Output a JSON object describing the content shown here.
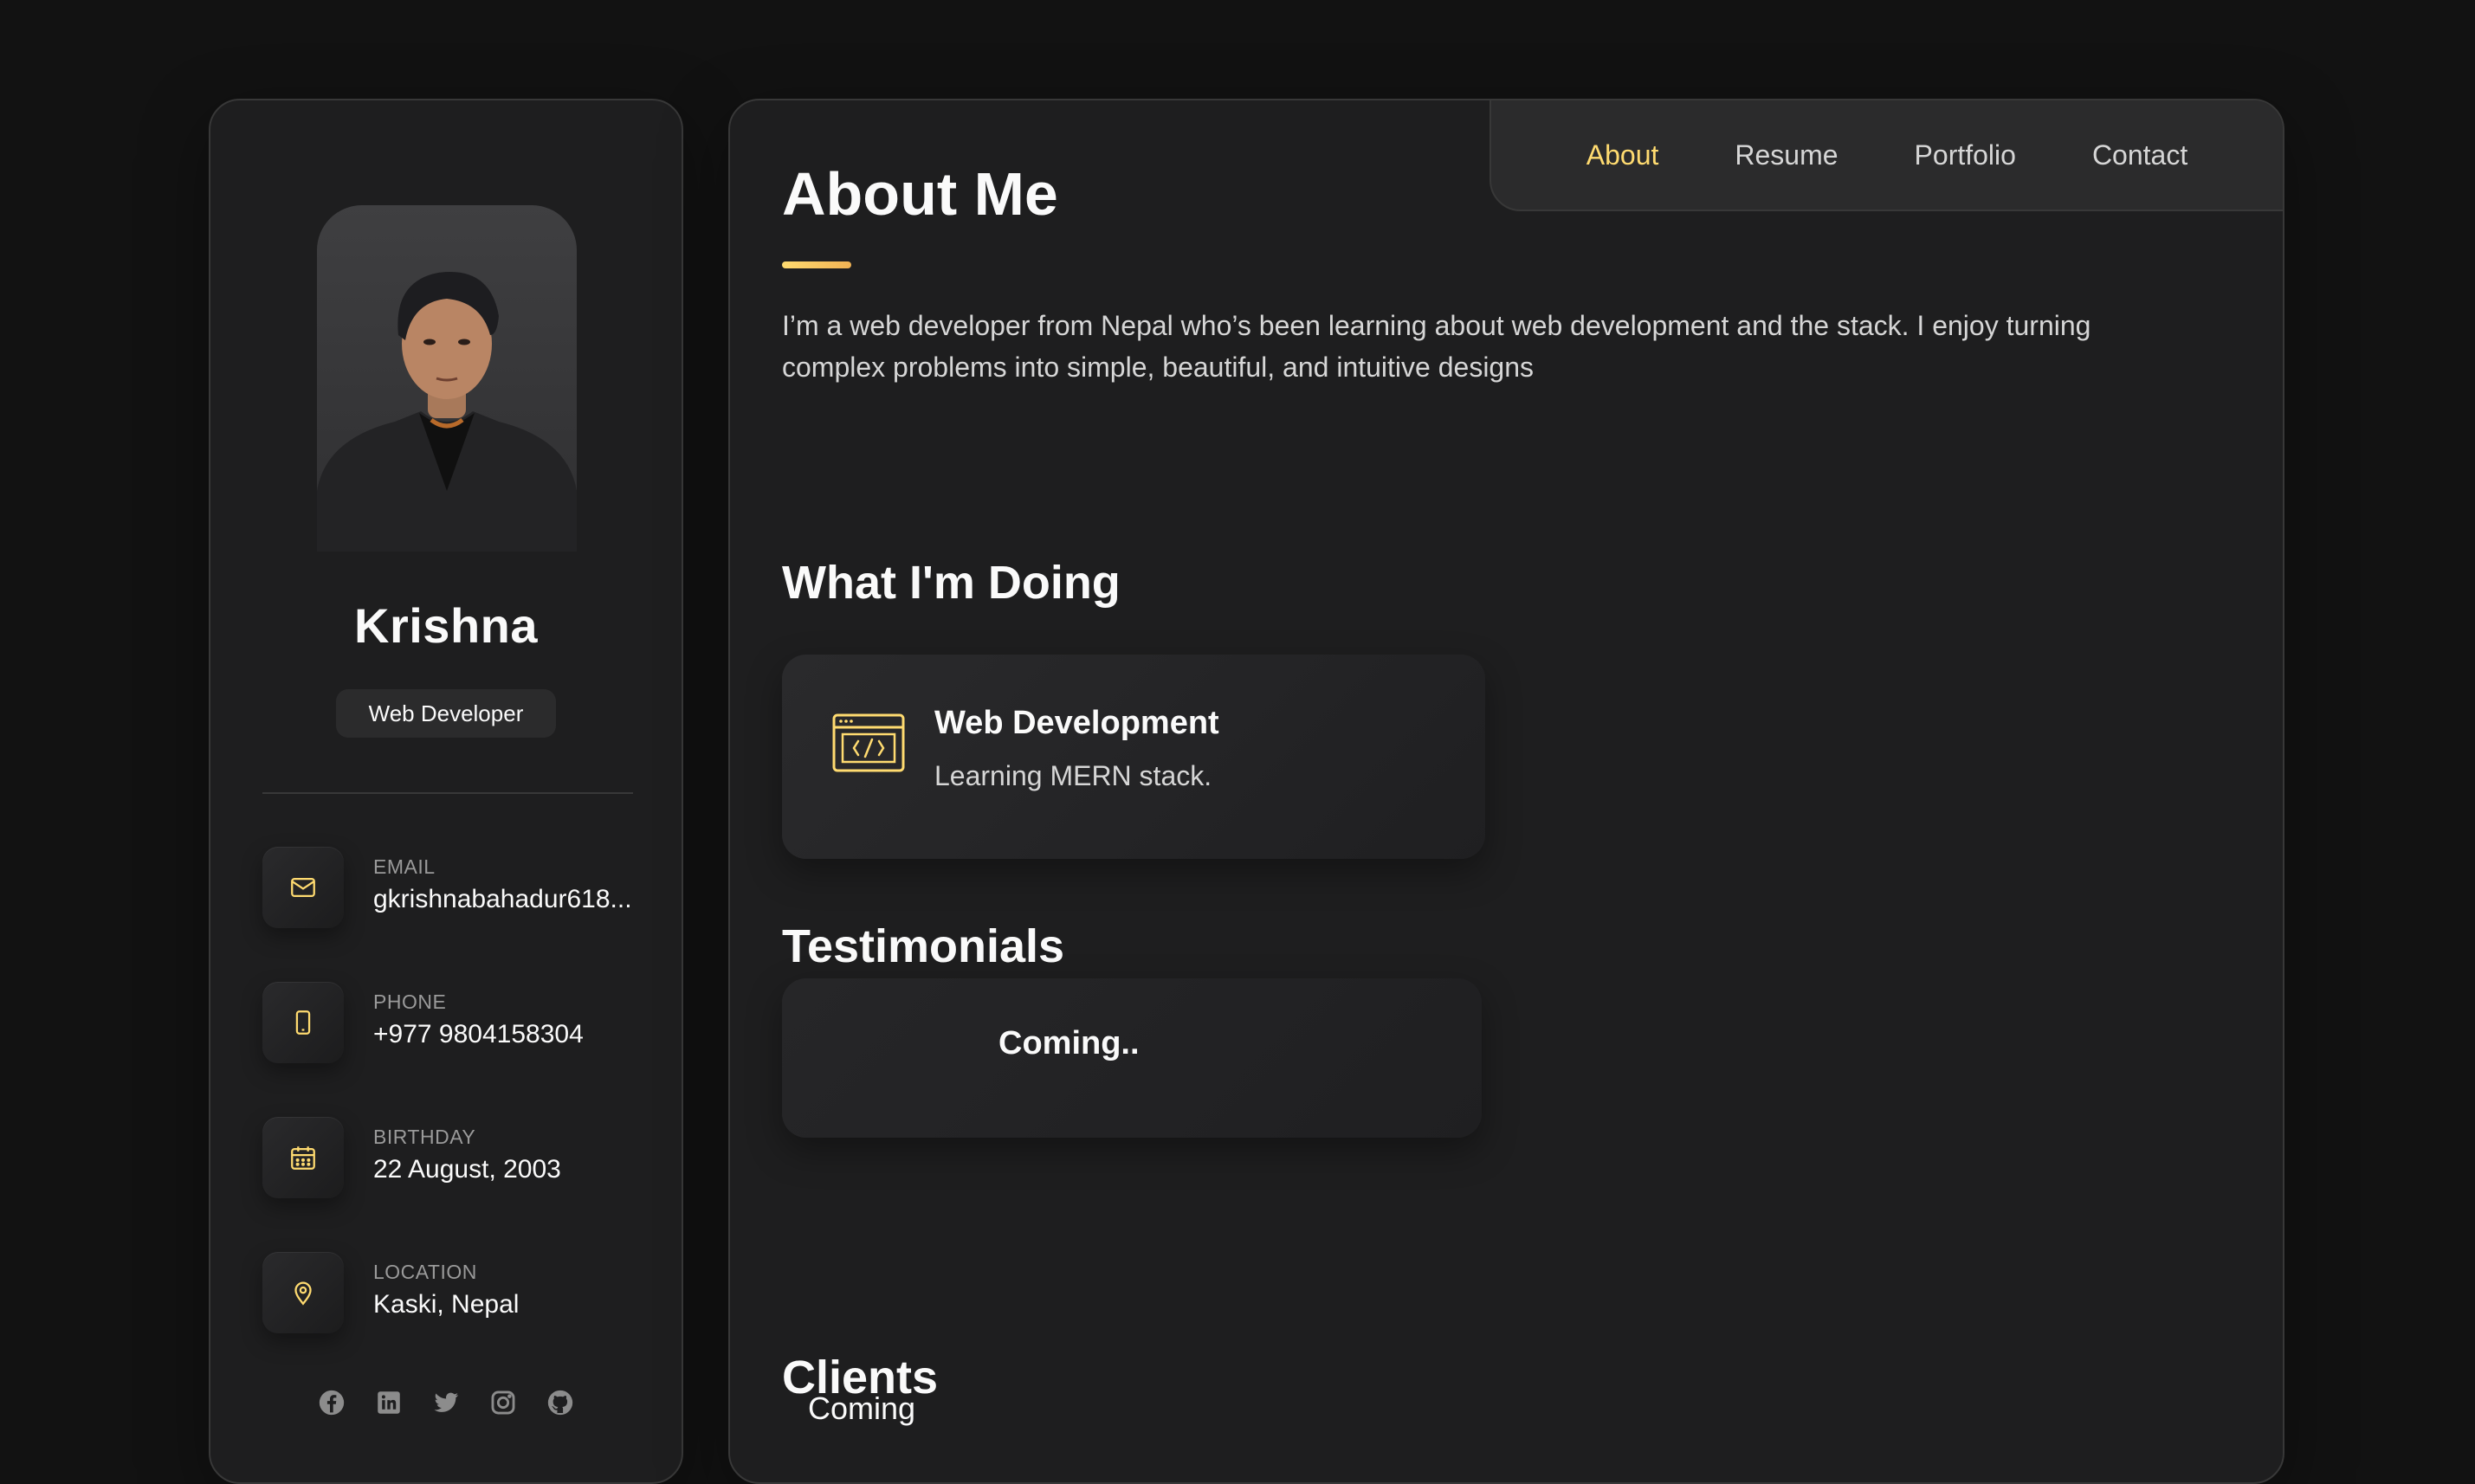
{
  "profile": {
    "name": "Krishna",
    "title": "Web Developer"
  },
  "contacts": [
    {
      "icon": "mail-icon",
      "label": "Email",
      "value": "gkrishnabahadur618..."
    },
    {
      "icon": "phone-icon",
      "label": "Phone",
      "value": "+977 9804158304"
    },
    {
      "icon": "calendar-icon",
      "label": "Birthday",
      "value": "22 August, 2003"
    },
    {
      "icon": "location-pin-icon",
      "label": "Location",
      "value": "Kaski, Nepal"
    }
  ],
  "socials": [
    "facebook-icon",
    "linkedin-icon",
    "twitter-icon",
    "instagram-icon",
    "github-icon"
  ],
  "nav": {
    "items": [
      {
        "label": "About",
        "active": true
      },
      {
        "label": "Resume",
        "active": false
      },
      {
        "label": "Portfolio",
        "active": false
      },
      {
        "label": "Contact",
        "active": false
      }
    ]
  },
  "about": {
    "heading": "About Me",
    "text": "I’m a web developer from Nepal who’s been learning about web development and the stack. I enjoy turning complex problems into simple, beautiful, and intuitive designs"
  },
  "doing": {
    "heading": "What I'm Doing",
    "service": {
      "icon": "code-window-icon",
      "title": "Web Development",
      "text": "Learning MERN stack."
    }
  },
  "testimonials": {
    "heading": "Testimonials",
    "text": "Coming.."
  },
  "clients": {
    "heading": "Clients",
    "text": "Coming"
  },
  "colors": {
    "background": "#121212",
    "card": "#1e1e1f",
    "border": "#383838",
    "accent": "#ffdb70",
    "text": "#fafafa",
    "muted": "#d6d6d6"
  }
}
